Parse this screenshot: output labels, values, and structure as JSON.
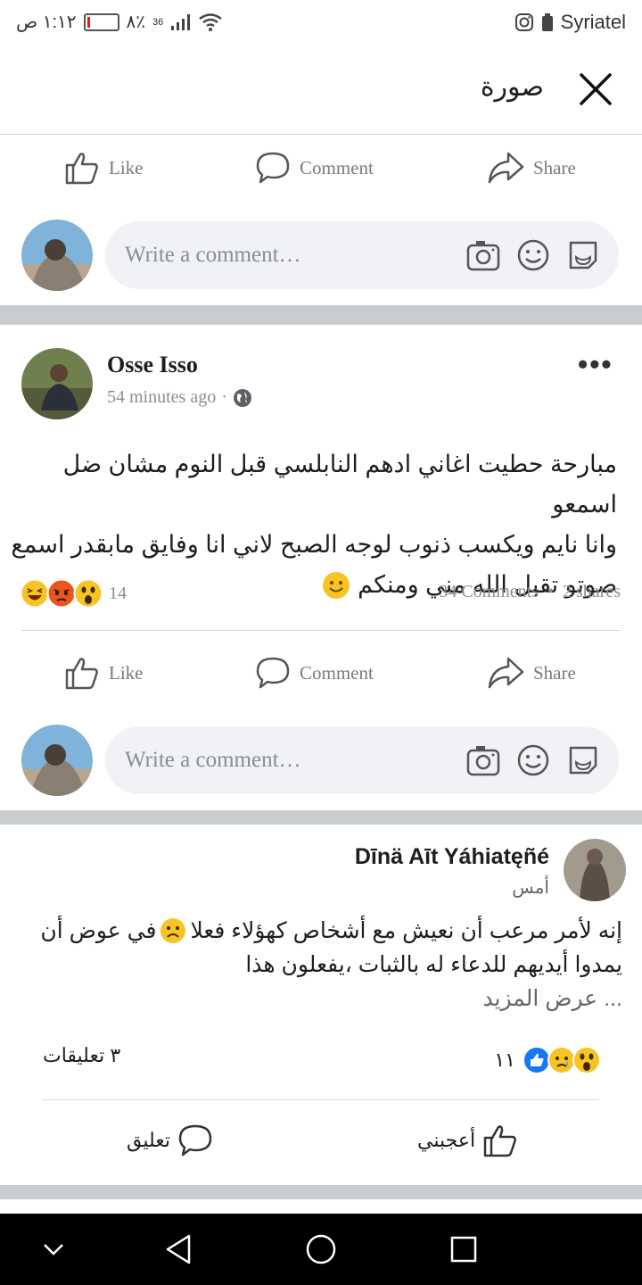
{
  "status": {
    "time": "١:١٢ ص",
    "battery": "٨٪",
    "signal": "36",
    "carrier": "Syriatel"
  },
  "header": {
    "title": "صورة"
  },
  "actions": {
    "like": "Like",
    "comment": "Comment",
    "share": "Share"
  },
  "composer": {
    "placeholder": "Write a comment…"
  },
  "post1": {
    "author": "Osse Isso",
    "time": "54 minutes ago",
    "text_line1": "مبارحة حطيت اغاني ادهم النابلسي قبل النوم مشان ضل اسمعو",
    "text_line2": "وانا نايم ويكسب ذنوب لوجه الصبح لاني انا وفايق مابقدر اسمع",
    "text_line3": "صوتو تقبل الله مني ومنكم",
    "reaction_count": "14",
    "comments": "34 Comments",
    "shares": "2 shares"
  },
  "post2": {
    "author": "Dīnä Aīt Yáhiatęñé",
    "time": "أمس",
    "text_line1": "إنه لأمر مرعب أن نعيش مع أشخاص كهؤلاء فعلا",
    "text_line1b": "في عوض أن",
    "text_line2": "يمدوا أيديهم للدعاء له بالثبات ،يفعلون هذا",
    "see_more": "... عرض المزيد",
    "comments": "٣ تعليقات",
    "reaction_count": "١١",
    "like": "أعجبني",
    "comment": "تعليق"
  },
  "colors": {
    "accent": "#1877f2",
    "separator": "#c9cccf",
    "muted": "#7a7a7a"
  }
}
